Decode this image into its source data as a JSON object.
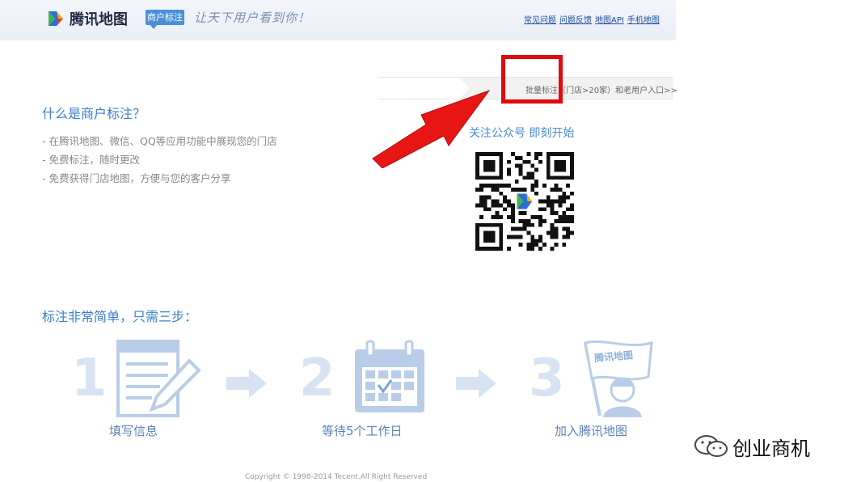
{
  "header": {
    "logo_text": "腾讯地图",
    "badge": "商户标注",
    "slogan": "让天下用户看到你！",
    "links": [
      "常见问题",
      "问题反馈",
      "地图API",
      "手机地图"
    ]
  },
  "batch_link": "批量标注（门店>20家）和老用户入口>>",
  "intro": {
    "title": "什么是商户标注？",
    "features": [
      "- 在腾讯地图、微信、QQ等应用功能中展现您的门店",
      "- 免费标注，随时更改",
      "- 免费获得门店地图，方便与您的客户分享"
    ]
  },
  "follow_text": "关注公众号  即刻开始",
  "steps": {
    "title": "标注非常简单，只需三步：",
    "items": [
      {
        "number": "1",
        "label": "填写信息"
      },
      {
        "number": "2",
        "label": "等待5个工作日"
      },
      {
        "number": "3",
        "label": "加入腾讯地图",
        "flag_text": "腾讯地图"
      }
    ]
  },
  "copyright": "Copyright © 1998-2014 Tecent.All Right Reserved",
  "watermark": "创业商机",
  "colors": {
    "accent": "#3a7fd0",
    "highlight": "#e10a0a",
    "step_icon": "#b9cde8"
  }
}
